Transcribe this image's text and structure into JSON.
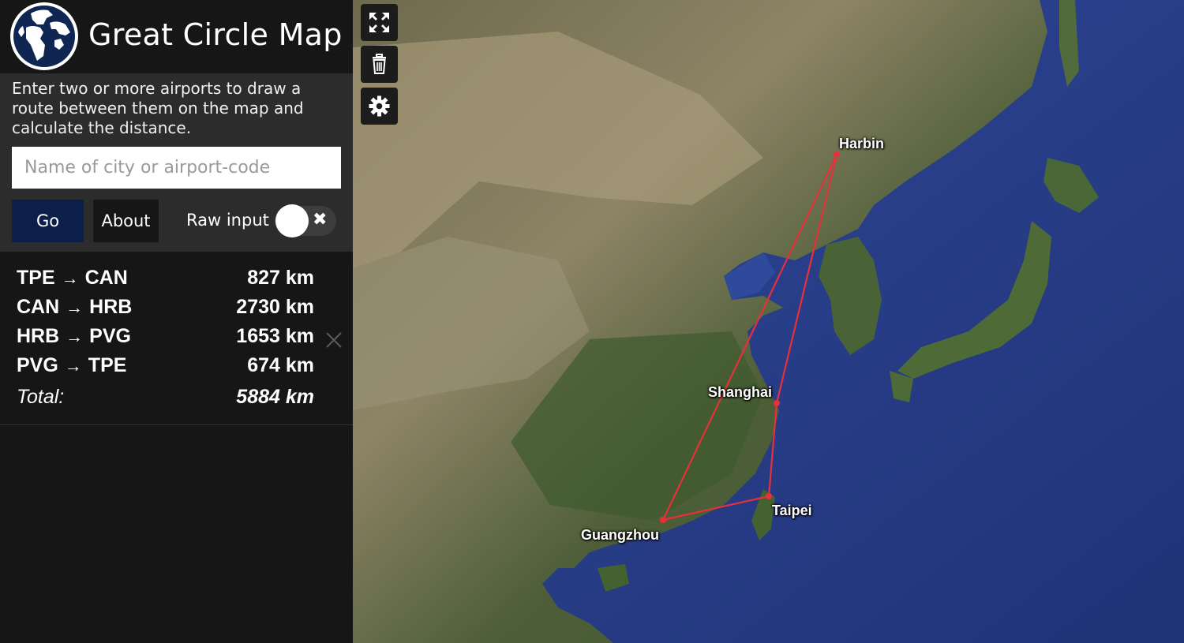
{
  "app": {
    "title": "Great Circle Map"
  },
  "intro": {
    "text": "Enter two or more airports to draw a route between them on the map and calculate the distance.",
    "input_placeholder": "Name of city or airport-code",
    "input_value": ""
  },
  "controls": {
    "go_label": "Go",
    "about_label": "About",
    "raw_input_label": "Raw input",
    "raw_input_on": false
  },
  "routes": [
    {
      "from": "TPE",
      "to": "CAN",
      "arrow": "→",
      "distance": "827 km"
    },
    {
      "from": "CAN",
      "to": "HRB",
      "arrow": "→",
      "distance": "2730 km"
    },
    {
      "from": "HRB",
      "to": "PVG",
      "arrow": "→",
      "distance": "1653 km"
    },
    {
      "from": "PVG",
      "to": "TPE",
      "arrow": "→",
      "distance": "674 km"
    }
  ],
  "total": {
    "label": "Total:",
    "value": "5884 km"
  },
  "map": {
    "controls": [
      "fullscreen-icon",
      "trash-icon",
      "gear-icon"
    ],
    "cities": [
      {
        "name": "Harbin"
      },
      {
        "name": "Shanghai"
      },
      {
        "name": "Taipei"
      },
      {
        "name": "Guangzhou"
      }
    ],
    "route_color": "#e8303a"
  },
  "colors": {
    "nav_blue": "#0c1f4a",
    "panel": "#2c2c2c",
    "background": "#161616"
  }
}
